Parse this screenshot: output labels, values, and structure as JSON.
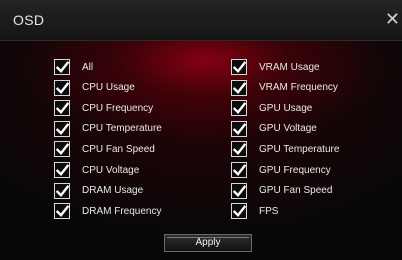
{
  "window": {
    "title": "OSD",
    "close_glyph": "✕"
  },
  "left_options": [
    {
      "label": "All",
      "checked": true
    },
    {
      "label": "CPU Usage",
      "checked": true
    },
    {
      "label": "CPU Frequency",
      "checked": true
    },
    {
      "label": "CPU Temperature",
      "checked": true
    },
    {
      "label": "CPU Fan Speed",
      "checked": true
    },
    {
      "label": "CPU Voltage",
      "checked": true
    },
    {
      "label": "DRAM Usage",
      "checked": true
    },
    {
      "label": "DRAM Frequency",
      "checked": true
    }
  ],
  "right_options": [
    {
      "label": "VRAM Usage",
      "checked": true
    },
    {
      "label": "VRAM Frequency",
      "checked": true
    },
    {
      "label": "GPU Usage",
      "checked": true
    },
    {
      "label": "GPU Voltage",
      "checked": true
    },
    {
      "label": "GPU Temperature",
      "checked": true
    },
    {
      "label": "GPU Frequency",
      "checked": true
    },
    {
      "label": "GPU Fan Speed",
      "checked": true
    },
    {
      "label": "FPS",
      "checked": true
    }
  ],
  "apply_label": "Apply",
  "colors": {
    "accent": "#8b0012",
    "text": "#e9e9e9",
    "checkmark": "#ffffff"
  }
}
